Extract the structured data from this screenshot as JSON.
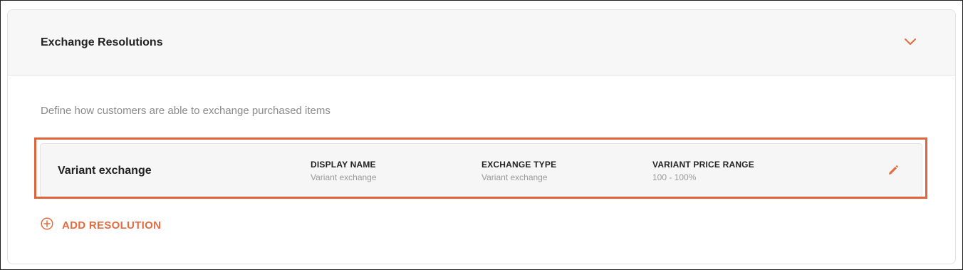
{
  "section": {
    "title": "Exchange Resolutions",
    "description": "Define how customers are able to exchange purchased items"
  },
  "resolution": {
    "name": "Variant exchange",
    "display_name_label": "DISPLAY NAME",
    "display_name_value": "Variant exchange",
    "exchange_type_label": "EXCHANGE TYPE",
    "exchange_type_value": "Variant exchange",
    "price_range_label": "VARIANT PRICE RANGE",
    "price_range_value": "100 - 100%"
  },
  "actions": {
    "add_resolution_label": "ADD RESOLUTION"
  },
  "icons": {
    "collapse": "chevron-down-icon",
    "edit": "pencil-icon",
    "add": "plus-circle-icon"
  },
  "colors": {
    "accent": "#e56a3e",
    "highlight_border": "#e0643a"
  }
}
